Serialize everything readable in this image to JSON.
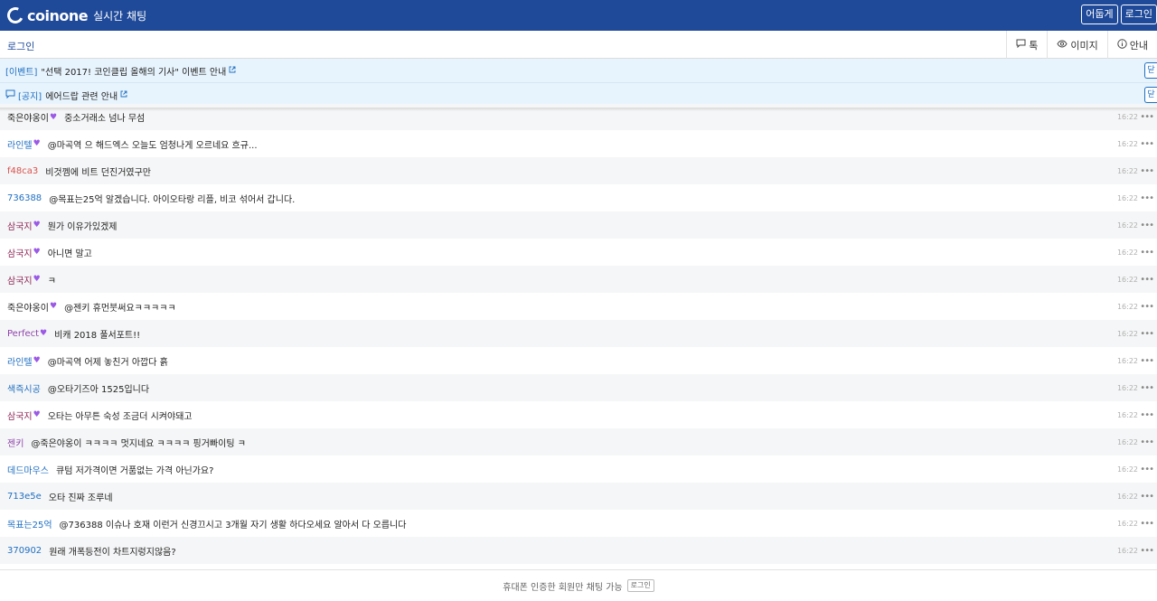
{
  "header": {
    "brand": "coinone",
    "subtitle": "실시간 채팅",
    "theme_button": "어둡게",
    "login_button": "로그인"
  },
  "subbar": {
    "login_link": "로그인",
    "tabs": [
      {
        "icon": "chat-bubble-icon",
        "label": "톡"
      },
      {
        "icon": "eye-icon",
        "label": "이미지"
      },
      {
        "icon": "info-icon",
        "label": "안내"
      }
    ]
  },
  "notices": [
    {
      "tag": "[이벤트]",
      "text": "\"선택 2017! 코인클립 올해의 기사\" 이벤트 안내",
      "close": "닫기"
    },
    {
      "tag": "[공지]",
      "text": "에어드랍 관련 안내",
      "close": "닫기"
    }
  ],
  "messages": [
    {
      "nick": "죽은야옹이",
      "heart": true,
      "nick_color": "#222222",
      "text": "중소거래소 넘나 무섬",
      "time": "16:22"
    },
    {
      "nick": "라인텔",
      "heart": true,
      "nick_color": "#1f6fc2",
      "text": "@마곡역 으 해드엑스 오늘도 엄청나게 오르네요 흐규...",
      "time": "16:22"
    },
    {
      "nick": "f48ca3",
      "heart": false,
      "nick_color": "#d9534f",
      "text": "비것껨에 비트 던진거였구만",
      "time": "16:22"
    },
    {
      "nick": "736388",
      "heart": false,
      "nick_color": "#1f6fc2",
      "text": "@목표는25억 알겠습니다. 아이오타랑 리플, 비코 섞어서 갑니다.",
      "time": "16:22"
    },
    {
      "nick": "삼국지",
      "heart": true,
      "nick_color": "#8b2252",
      "text": "뭔가 이유가있겠제",
      "time": "16:22"
    },
    {
      "nick": "삼국지",
      "heart": true,
      "nick_color": "#8b2252",
      "text": "아니면 말고",
      "time": "16:22"
    },
    {
      "nick": "삼국지",
      "heart": true,
      "nick_color": "#8b2252",
      "text": "ㅋ",
      "time": "16:22"
    },
    {
      "nick": "죽은야옹이",
      "heart": true,
      "nick_color": "#222222",
      "text": "@젠키 휴먼붓써요ㅋㅋㅋㅋㅋ",
      "time": "16:22"
    },
    {
      "nick": "Perfect",
      "heart": true,
      "nick_color": "#8e44ad",
      "text": "비캐 2018 풀서포트!!",
      "time": "16:22"
    },
    {
      "nick": "라인텔",
      "heart": true,
      "nick_color": "#1f6fc2",
      "text": "@마곡역 어제 놓친거 아깝다 흙",
      "time": "16:22"
    },
    {
      "nick": "색즉시공",
      "heart": false,
      "nick_color": "#1f6fc2",
      "text": "@오타기즈아 1525입니다",
      "time": "16:22"
    },
    {
      "nick": "삼국지",
      "heart": true,
      "nick_color": "#8b2252",
      "text": "오타는 아무튼 숙성 조금더 시켜야돼고",
      "time": "16:22"
    },
    {
      "nick": "젠키",
      "heart": false,
      "nick_color": "#8e44ad",
      "text": "@죽은야옹이 ㅋㅋㅋㅋ 멋지네요 ㅋㅋㅋㅋ 핑거빠이팅 ㅋ",
      "time": "16:22"
    },
    {
      "nick": "데드마우스",
      "heart": false,
      "nick_color": "#1f6fc2",
      "text": "큐텀 저가격이면 거품없는 가격 아닌가요?",
      "time": "16:22"
    },
    {
      "nick": "713e5e",
      "heart": false,
      "nick_color": "#1f6fc2",
      "text": "오타 진짜 조루네",
      "time": "16:22"
    },
    {
      "nick": "목표는25억",
      "heart": false,
      "nick_color": "#1f6fc2",
      "text": "@736388 이슈나 호재 이런거 신경끄시고 3개월 자기 생활 하다오세요 알아서 다 오릅니다",
      "time": "16:22"
    },
    {
      "nick": "370902",
      "heart": false,
      "nick_color": "#1f6fc2",
      "text": "원래 개폭등전이 차트지렁지않음?",
      "time": "16:22"
    }
  ],
  "footer": {
    "text": "휴대폰 인증한 회원만 채팅 가능",
    "login_label": "로그인"
  },
  "colors": {
    "brand": "#1f4a99",
    "notice_bg": "#e8f4fd",
    "heart": "#9b59e6"
  }
}
